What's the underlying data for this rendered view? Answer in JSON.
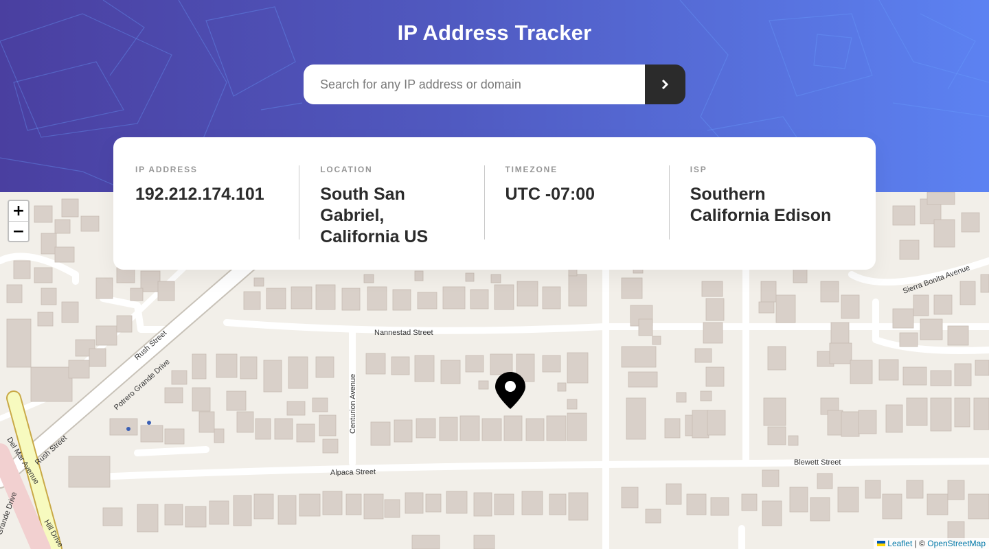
{
  "app": {
    "title": "IP Address Tracker"
  },
  "search": {
    "placeholder": "Search for any IP address or domain",
    "value": "",
    "button_icon": "chevron-right-icon"
  },
  "info": [
    {
      "label": "IP Address",
      "value": "192.212.174.101"
    },
    {
      "label": "Location",
      "value": "South San Gabriel, California US"
    },
    {
      "label": "Timezone",
      "value": "UTC -07:00"
    },
    {
      "label": "ISP",
      "value": "Southern California Edison"
    }
  ],
  "map": {
    "zoom_in": "+",
    "zoom_out": "−",
    "marker_icon": "location-pin-icon",
    "attribution": {
      "leaflet": "Leaflet",
      "separator": "| ©",
      "osm": "OpenStreetMap"
    },
    "streets": [
      "Nannestad Street",
      "Alpaca Street",
      "Blewett Street",
      "Centurion Avenue",
      "Rush Street",
      "Potrero Grande Drive",
      "Sierra Bonita Avenue",
      "Del Mar Avenue",
      "Hill Drive",
      "Grande Drive"
    ]
  },
  "colors": {
    "header_start": "#4a3fa0",
    "header_end": "#5c82f2",
    "dark": "#2b2b2b",
    "label_gray": "#969696",
    "map_bg": "#f2efe9",
    "building": "#d9d0c9"
  }
}
